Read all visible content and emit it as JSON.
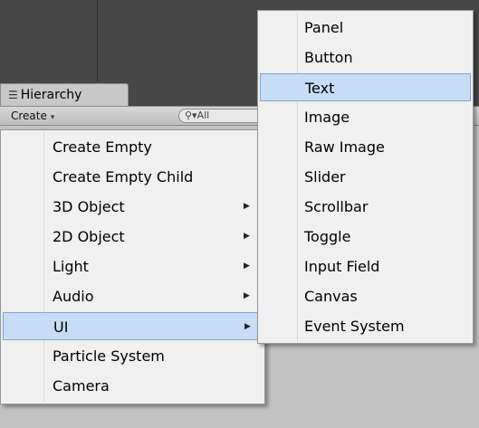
{
  "hierarchy": {
    "tab_label": "Hierarchy",
    "create_label": "Create",
    "search_placeholder": "All"
  },
  "create_menu": {
    "items": [
      {
        "label": "Create Empty",
        "submenu": false
      },
      {
        "label": "Create Empty Child",
        "submenu": false
      },
      {
        "label": "3D Object",
        "submenu": true
      },
      {
        "label": "2D Object",
        "submenu": true
      },
      {
        "label": "Light",
        "submenu": true
      },
      {
        "label": "Audio",
        "submenu": true
      },
      {
        "label": "UI",
        "submenu": true,
        "highlighted": true
      },
      {
        "label": "Particle System",
        "submenu": false
      },
      {
        "label": "Camera",
        "submenu": false
      }
    ]
  },
  "ui_submenu": {
    "items": [
      {
        "label": "Panel"
      },
      {
        "label": "Button"
      },
      {
        "label": "Text",
        "highlighted": true
      },
      {
        "label": "Image"
      },
      {
        "label": "Raw Image"
      },
      {
        "label": "Slider"
      },
      {
        "label": "Scrollbar"
      },
      {
        "label": "Toggle"
      },
      {
        "label": "Input Field"
      },
      {
        "label": "Canvas"
      },
      {
        "label": "Event System"
      }
    ]
  },
  "icons": {
    "tab_icon": "list-icon",
    "submenu_arrow": "triangle-right-icon",
    "search_icon": "magnifier-dropdown-icon"
  },
  "colors": {
    "highlight_fill": "#c6ddf5",
    "highlight_border": "#7aa6d8",
    "menu_bg": "#f0f0f0",
    "scene_bg": "#474747"
  }
}
